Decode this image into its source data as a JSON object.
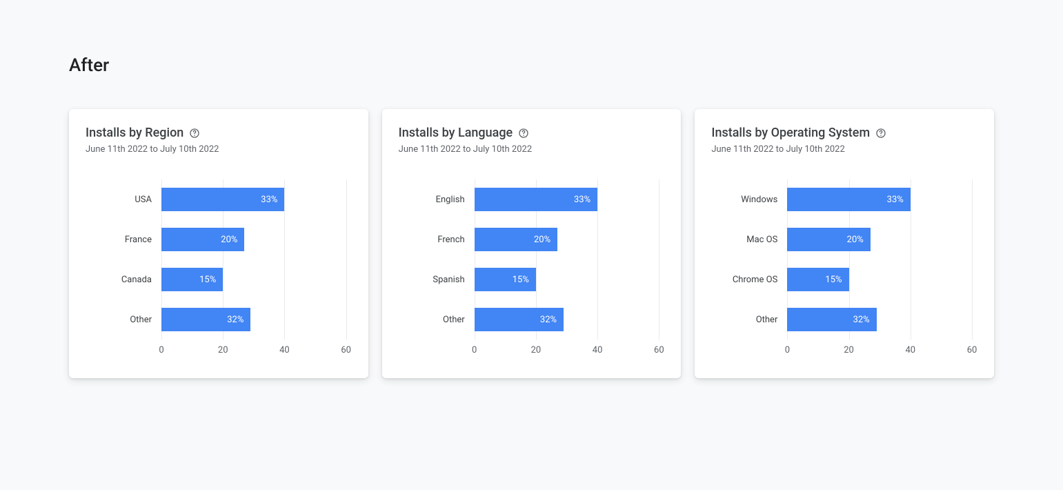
{
  "page_title": "After",
  "date_range": "June 11th 2022 to July 10th 2022",
  "axis_ticks": [
    0,
    20,
    40,
    60
  ],
  "axis_max": 60,
  "chart_data": [
    {
      "type": "bar",
      "title": "Installs by Region",
      "categories": [
        "USA",
        "France",
        "Canada",
        "Other"
      ],
      "values": [
        33,
        20,
        15,
        32
      ],
      "value_labels": [
        "33%",
        "20%",
        "15%",
        "32%"
      ],
      "xlabel": "",
      "ylabel": "",
      "xlim": [
        0,
        60
      ]
    },
    {
      "type": "bar",
      "title": "Installs by Language",
      "categories": [
        "English",
        "French",
        "Spanish",
        "Other"
      ],
      "values": [
        33,
        20,
        15,
        32
      ],
      "value_labels": [
        "33%",
        "20%",
        "15%",
        "32%"
      ],
      "xlabel": "",
      "ylabel": "",
      "xlim": [
        0,
        60
      ]
    },
    {
      "type": "bar",
      "title": "Installs by Operating System",
      "categories": [
        "Windows",
        "Mac OS",
        "Chrome OS",
        "Other"
      ],
      "values": [
        33,
        20,
        15,
        32
      ],
      "value_labels": [
        "33%",
        "20%",
        "15%",
        "32%"
      ],
      "xlabel": "",
      "ylabel": "",
      "xlim": [
        0,
        60
      ]
    }
  ],
  "bar_extent_values": [
    40,
    27,
    20,
    29
  ]
}
